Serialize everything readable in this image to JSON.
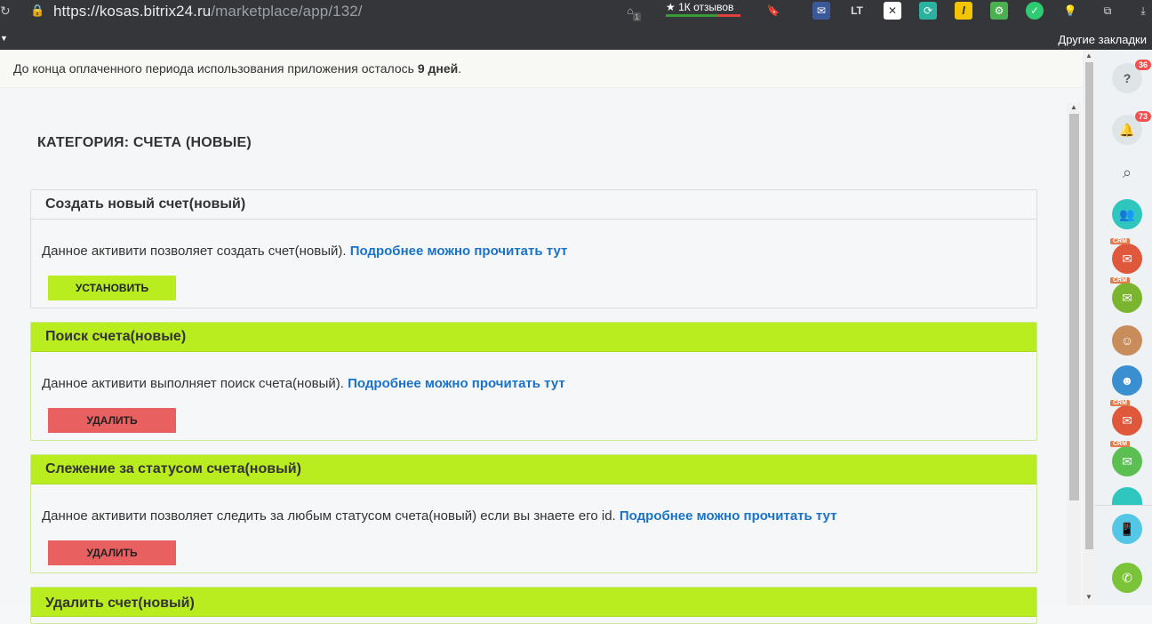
{
  "browser": {
    "url_host": "https://kosas.bitrix24.ru",
    "url_path": "/marketplace/app/132/",
    "reviews": "1К отзывов",
    "other_bookmarks": "Другие закладки",
    "ext_badge": "1"
  },
  "notice": {
    "prefix": "До конца оплаченного периода использования приложения осталось ",
    "days": "9 дней",
    "suffix": "."
  },
  "category": {
    "title": "КАТЕГОРИЯ: СЧЕТА (НОВЫЕ)"
  },
  "cards": [
    {
      "title": "Создать новый счет(новый)",
      "desc": "Данное активити позволяет создать счет(новый).",
      "link": "Подробнее можно прочитать тут",
      "button": "УСТАНОВИТЬ"
    },
    {
      "title": "Поиск счета(новые)",
      "desc": "Данное активити выполняет поиск счета(новый).",
      "link": "Подробнее можно прочитать тут",
      "button": "УДАЛИТЬ"
    },
    {
      "title": "Слежение за статусом счета(новый)",
      "desc": "Данное активити позволяет следить за любым статусом счета(новый) если вы знаете его id.",
      "link": "Подробнее можно прочитать тут",
      "button": "УДАЛИТЬ"
    },
    {
      "title": "Удалить счет(новый)"
    }
  ],
  "sidebar": {
    "help_badge": "36",
    "notify_badge": "73",
    "crm_tag": "CRM"
  },
  "colors": {
    "green": "#b9ed1f",
    "red": "#e86060",
    "link": "#1a73c8"
  }
}
